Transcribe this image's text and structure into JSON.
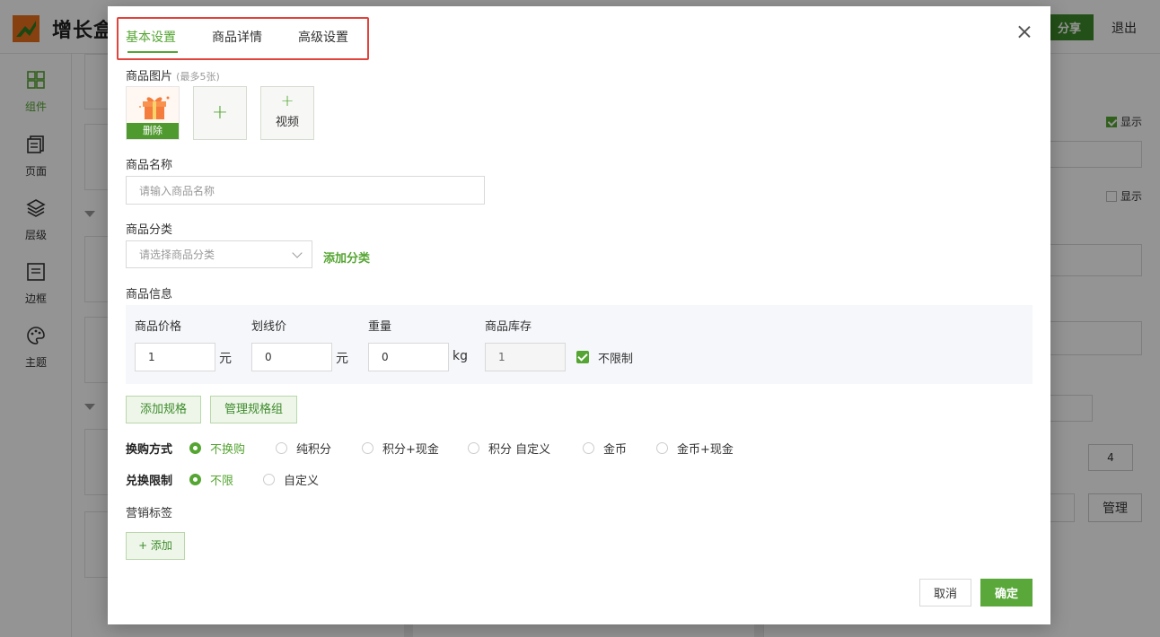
{
  "app": {
    "brand": "增长盒",
    "share_label": "分享",
    "logout_label": "退出",
    "brand_color": "#55a532"
  },
  "rail": [
    {
      "label": "组件",
      "icon": "grid-icon",
      "active": true
    },
    {
      "label": "页面",
      "icon": "pages-icon"
    },
    {
      "label": "层级",
      "icon": "layers-icon"
    },
    {
      "label": "边框",
      "icon": "border-icon"
    },
    {
      "label": "主题",
      "icon": "palette-icon"
    }
  ],
  "right_panel": {
    "show_label_1": "显示",
    "show_label_2": "显示",
    "count_value": "4",
    "manage_label": "管理"
  },
  "modal": {
    "tabs": [
      "基本设置",
      "商品详情",
      "高级设置"
    ],
    "active_tab": "基本设置",
    "images": {
      "label": "商品图片",
      "hint": "(最多5张)",
      "delete_label": "删除",
      "add_symbol": "+",
      "video_label": "视频"
    },
    "name": {
      "label": "商品名称",
      "placeholder": "请输入商品名称"
    },
    "category": {
      "label": "商品分类",
      "placeholder": "请选择商品分类",
      "add_label": "添加分类"
    },
    "info": {
      "label": "商品信息",
      "price_label": "商品价格",
      "price_value": "1",
      "price_unit": "元",
      "strike_label": "划线价",
      "strike_value": "0",
      "strike_unit": "元",
      "weight_label": "重量",
      "weight_value": "0",
      "weight_unit": "kg",
      "stock_label": "商品库存",
      "stock_value": "1",
      "unlimited_label": "不限制",
      "unlimited_checked": true
    },
    "spec_buttons": {
      "add_spec": "添加规格",
      "manage_spec_group": "管理规格组"
    },
    "exchange_mode": {
      "label": "换购方式",
      "options": [
        "不换购",
        "纯积分",
        "积分+现金",
        "积分 自定义",
        "金币",
        "金币+现金"
      ],
      "selected": "不换购"
    },
    "exchange_limit": {
      "label": "兑换限制",
      "options": [
        "不限",
        "自定义"
      ],
      "selected": "不限"
    },
    "marketing": {
      "label": "营销标签",
      "add_label": "+ 添加"
    },
    "footer": {
      "cancel": "取消",
      "confirm": "确定"
    }
  }
}
